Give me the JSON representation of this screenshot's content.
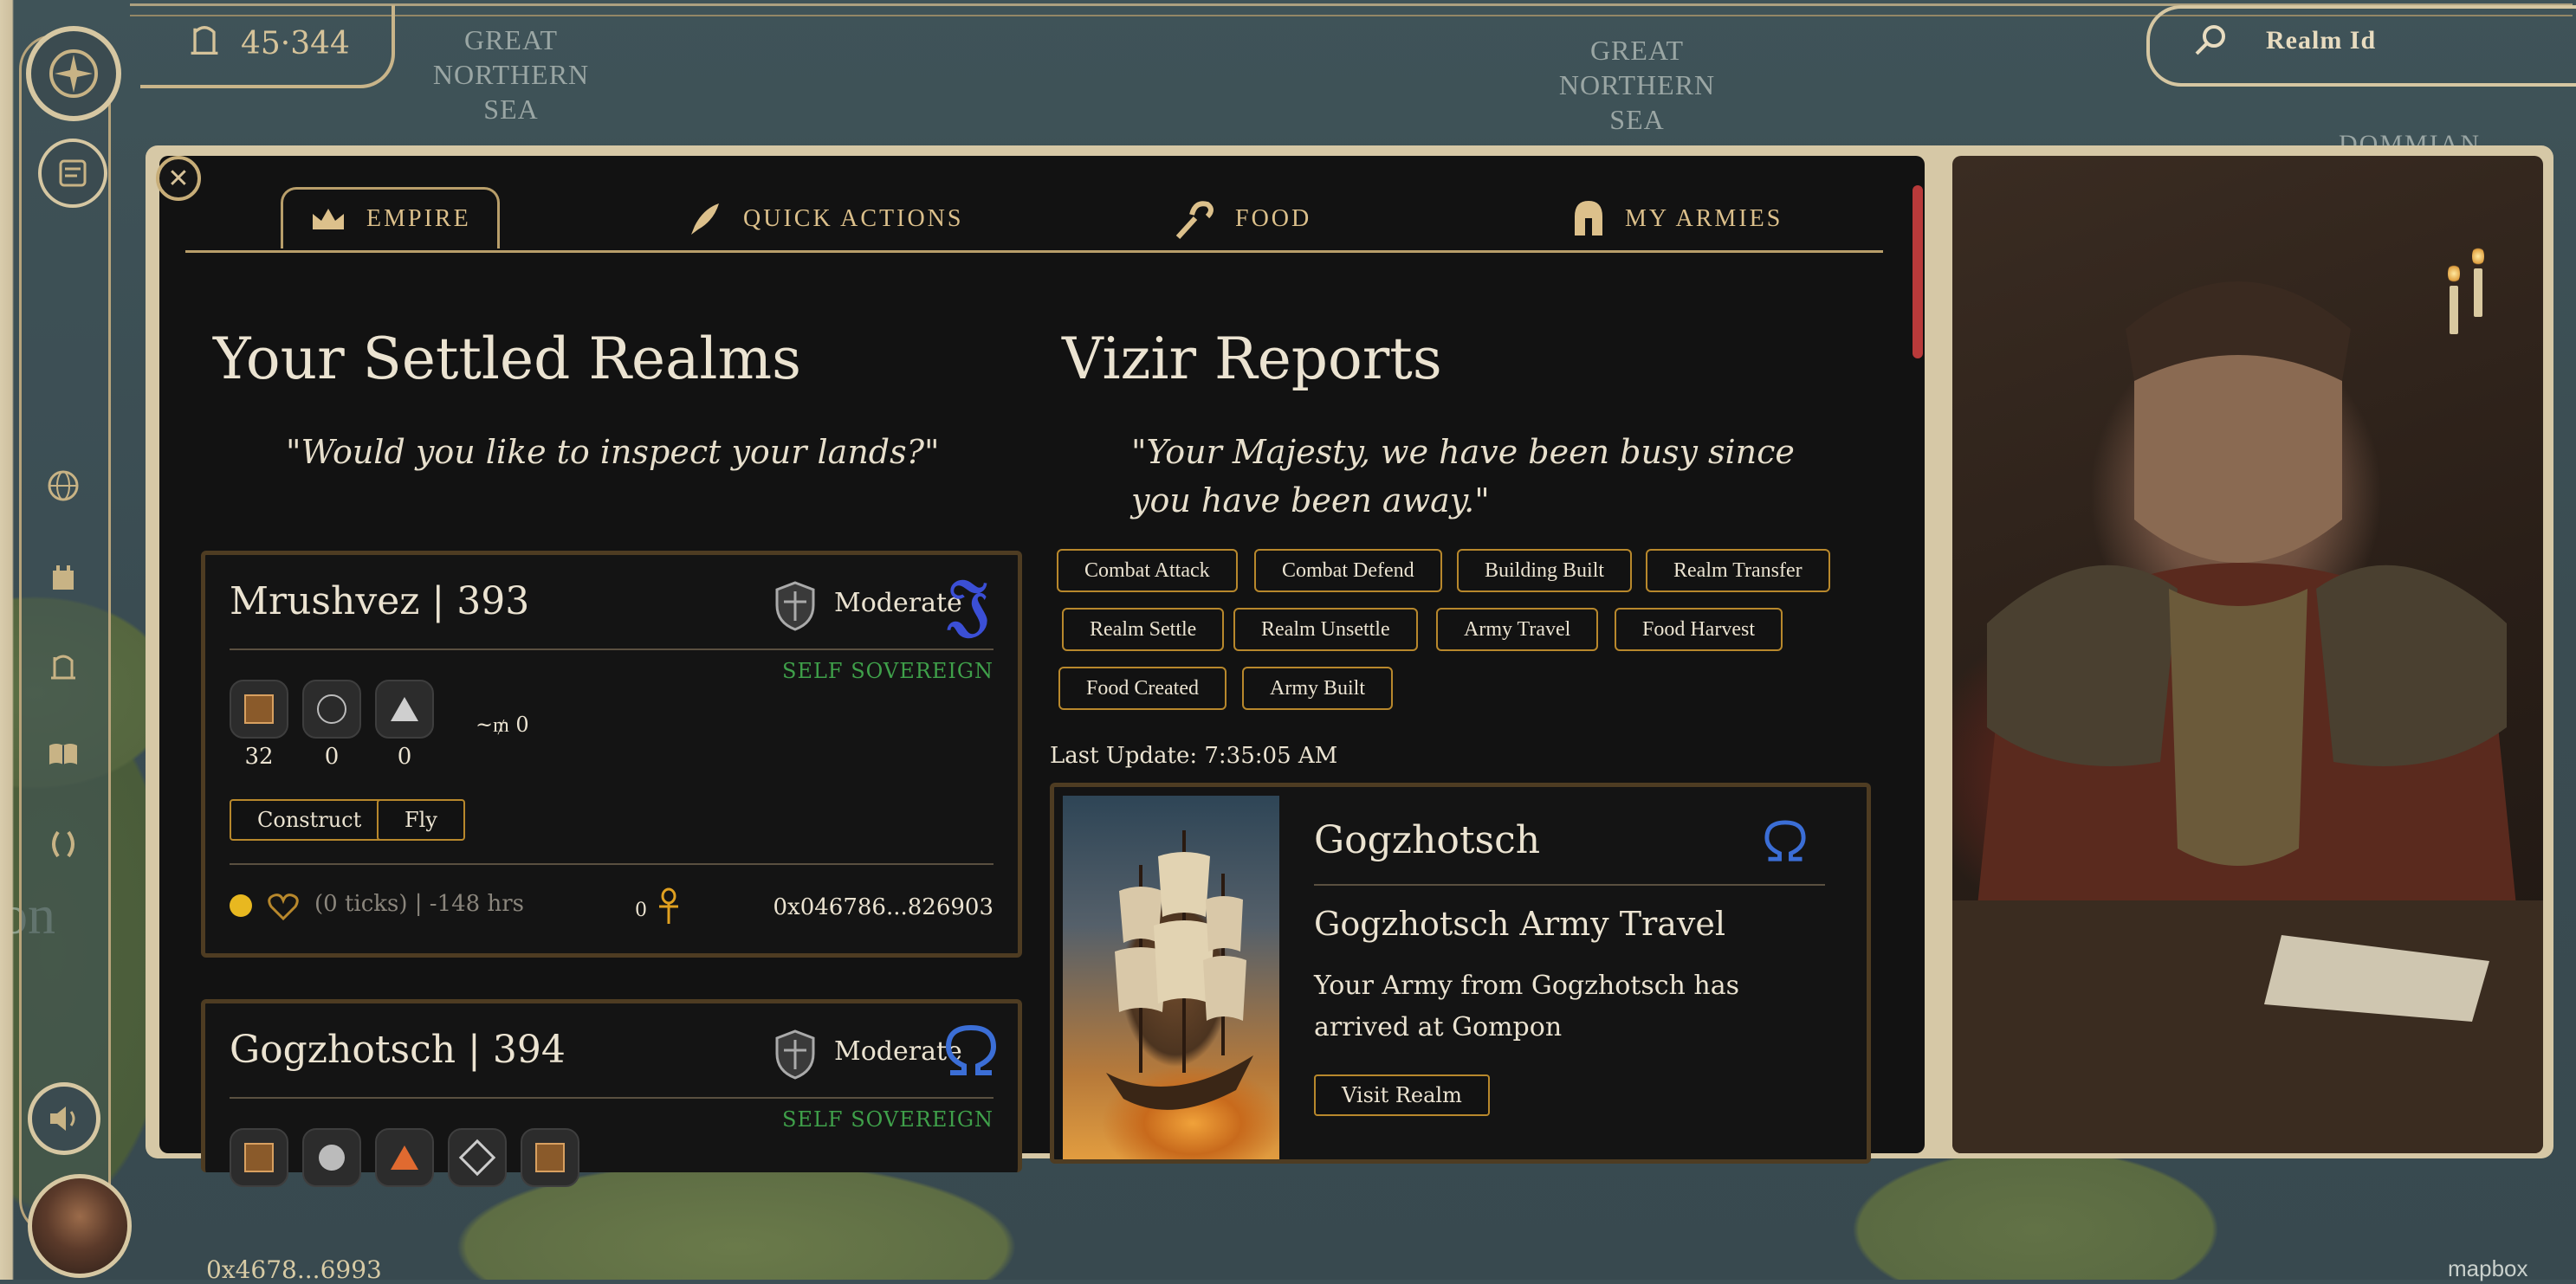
{
  "app": {
    "coins": "45·344",
    "search_label": "Realm Id",
    "wallet": "0x4678...6993",
    "mapbox": "mapbox"
  },
  "map_labels": {
    "sea_left": "GREAT NORTHERN SEA",
    "sea_center": "GREAT NORTHERN SEA",
    "ocean_right": "DOMMIAN OCEAN",
    "edge_text": "on"
  },
  "tabs": [
    {
      "label": "EMPIRE",
      "icon": "crown-icon",
      "active": true
    },
    {
      "label": "QUICK ACTIONS",
      "icon": "quill-icon",
      "active": false
    },
    {
      "label": "FOOD",
      "icon": "hook-icon",
      "active": false
    },
    {
      "label": "MY ARMIES",
      "icon": "helmet-icon",
      "active": false
    }
  ],
  "realms_section": {
    "title": "Your Settled Realms",
    "quote": "\"Would you like to inspect your lands?\""
  },
  "realms": [
    {
      "name": "Mrushvez | 393",
      "order": "Moderate",
      "order_glyph": "𝔍",
      "status": "SELF SOVEREIGN",
      "resources": [
        "32",
        "0",
        "0"
      ],
      "lords_text": "~₥ 0",
      "buttons": [
        "Construct",
        "Fly"
      ],
      "ticks": "(0 ticks) | -148 hrs",
      "relic_count": "0",
      "owner": "0x046786...826903"
    },
    {
      "name": "Gogzhotsch | 394",
      "order": "Moderate",
      "order_glyph": "Ω",
      "status": "SELF SOVEREIGN"
    }
  ],
  "vizir": {
    "title": "Vizir Reports",
    "quote": "\"Your Majesty, we have been busy since you have been away.\"",
    "filters": [
      "Combat Attack",
      "Combat Defend",
      "Building Built",
      "Realm Transfer",
      "Realm Settle",
      "Realm Unsettle",
      "Army Travel",
      "Food Harvest",
      "Food Created",
      "Army Built"
    ],
    "last_update": "Last Update: 7:35:05 AM",
    "report": {
      "realm": "Gogzhotsch",
      "title": "Gogzhotsch Army Travel",
      "body": "Your Army from Gogzhotsch has arrived at Gompon",
      "button": "Visit Realm"
    }
  },
  "colors": {
    "gold": "#dcc08b",
    "order_blue": "#3b4fd6",
    "sovereign_green": "#3fa04a",
    "border_brown": "#4e3c22"
  }
}
